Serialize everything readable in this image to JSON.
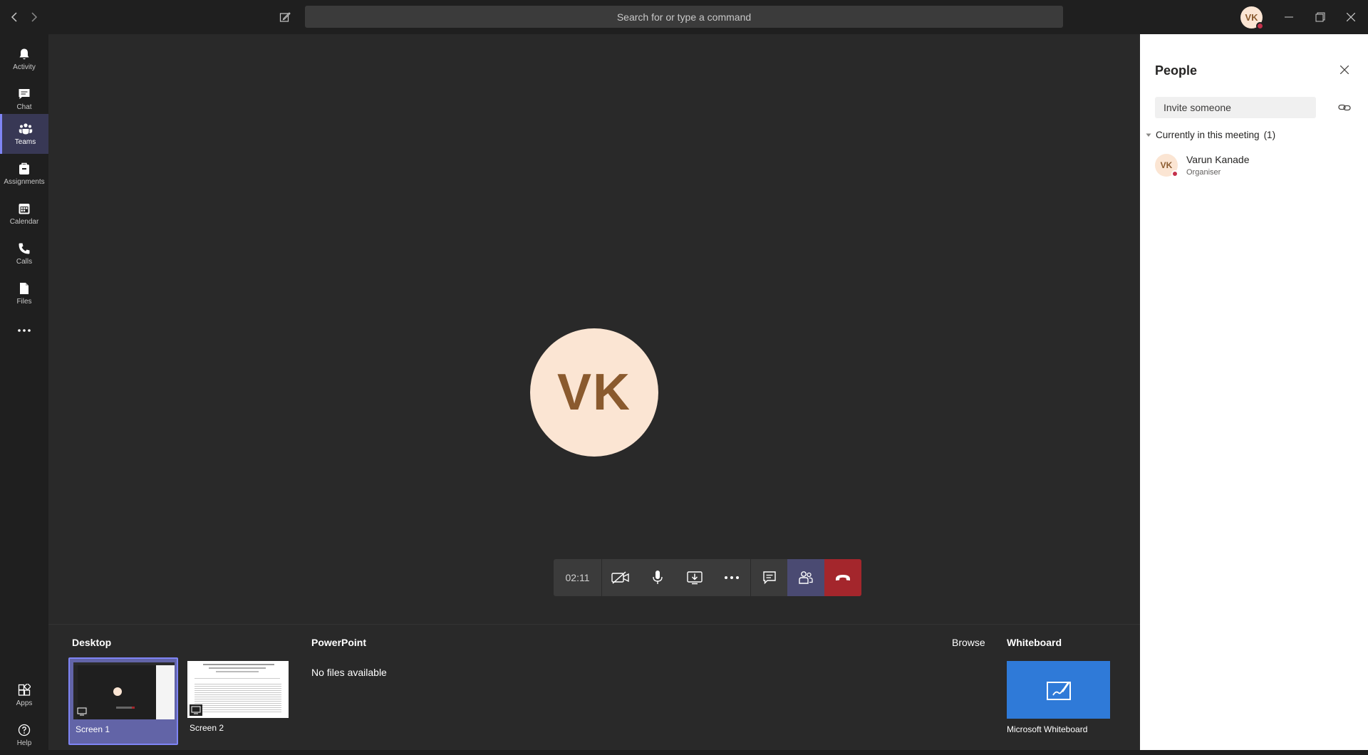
{
  "titlebar": {
    "search_placeholder": "Search for or type a command",
    "profile_initials": "VK"
  },
  "rail": {
    "items": [
      {
        "label": "Activity",
        "icon": "bell-icon"
      },
      {
        "label": "Chat",
        "icon": "chat-icon"
      },
      {
        "label": "Teams",
        "icon": "teams-icon",
        "active": true
      },
      {
        "label": "Assignments",
        "icon": "assignments-icon"
      },
      {
        "label": "Calendar",
        "icon": "calendar-icon"
      },
      {
        "label": "Calls",
        "icon": "phone-icon"
      },
      {
        "label": "Files",
        "icon": "file-icon"
      }
    ],
    "bottom": [
      {
        "label": "Apps",
        "icon": "apps-icon"
      },
      {
        "label": "Help",
        "icon": "help-icon"
      }
    ]
  },
  "stage": {
    "avatar_initials": "VK",
    "timer": "02:11"
  },
  "tray": {
    "desktop_heading": "Desktop",
    "screens": [
      {
        "label": "Screen 1",
        "selected": true
      },
      {
        "label": "Screen 2",
        "selected": false
      }
    ],
    "powerpoint_heading": "PowerPoint",
    "no_files": "No files available",
    "browse_label": "Browse",
    "whiteboard_heading": "Whiteboard",
    "whiteboard_label": "Microsoft Whiteboard"
  },
  "people_panel": {
    "title": "People",
    "invite_placeholder": "Invite someone",
    "section_label": "Currently in this meeting",
    "section_count": "(1)",
    "participants": [
      {
        "initials": "VK",
        "name": "Varun Kanade",
        "role": "Organiser"
      }
    ]
  },
  "colors": {
    "accent": "#6264a7",
    "hangup": "#a4262c",
    "presence_busy": "#c4314b",
    "whiteboard": "#2f7ad8"
  }
}
